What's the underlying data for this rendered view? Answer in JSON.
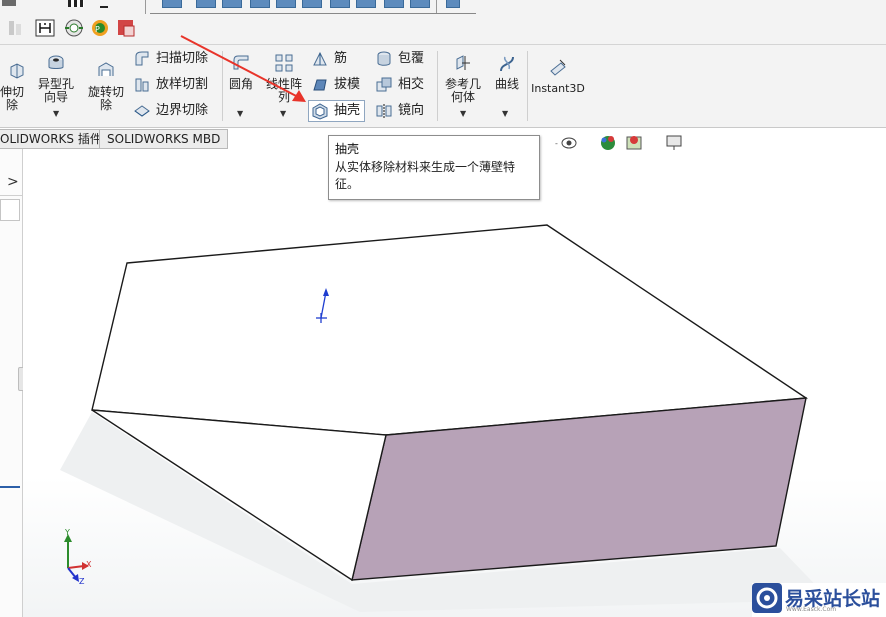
{
  "ribbon": {
    "extrude_cut": {
      "line1": "伸切",
      "line2": "除"
    },
    "hole_wizard": {
      "line1": "异型孔",
      "line2": "向导"
    },
    "revolve_cut": {
      "line1": "旋转切",
      "line2": "除"
    },
    "swept_cut": "扫描切除",
    "loft_cut": "放样切割",
    "boundary_cut": "边界切除",
    "fillet": "圆角",
    "linear_pattern": {
      "line1": "线性阵",
      "line2": "列"
    },
    "rib": "筋",
    "draft": "拔模",
    "shell": "抽壳",
    "wrap": "包覆",
    "intersect": "相交",
    "mirror": "镜向",
    "reference_geometry": {
      "line1": "参考几",
      "line2": "何体"
    },
    "curves": "曲线",
    "instant3d": "Instant3D",
    "dropdown_glyph": "▼"
  },
  "tabs": [
    {
      "label": "OLIDWORKS 插件"
    },
    {
      "label": "SOLIDWORKS MBD"
    }
  ],
  "tooltip": {
    "title": "抽壳",
    "description": "从实体移除材料来生成一个薄壁特征。"
  },
  "left_panel": {
    "expand_glyph": ">"
  },
  "triad": {
    "x": "X",
    "y": "Y",
    "z": "Z"
  },
  "watermark": {
    "text": "易采站长站",
    "sub": "Www.Easck.Com"
  },
  "colors": {
    "side_face": "#b7a2b7",
    "top_face": "#ffffff",
    "edge": "#1a1a1a",
    "arrow": "#e8342a",
    "axis_blue": "#1f3ed0",
    "axis_x": "#d13232",
    "axis_y": "#2c8c2c",
    "axis_z": "#2233cc"
  },
  "icons": {
    "extrude_cut": "extrude-cut-icon",
    "hole_wizard": "hole-wizard-icon",
    "revolve_cut": "revolve-cut-icon",
    "swept_cut": "swept-cut-icon",
    "loft_cut": "loft-cut-icon",
    "boundary_cut": "boundary-cut-icon",
    "fillet": "fillet-icon",
    "linear_pattern": "linear-pattern-icon",
    "rib": "rib-icon",
    "draft": "draft-icon",
    "shell": "shell-icon",
    "wrap": "wrap-icon",
    "intersect": "intersect-icon",
    "mirror": "mirror-icon",
    "reference_geometry": "reference-geometry-icon",
    "curves": "curves-icon",
    "instant3d": "instant3d-icon"
  }
}
